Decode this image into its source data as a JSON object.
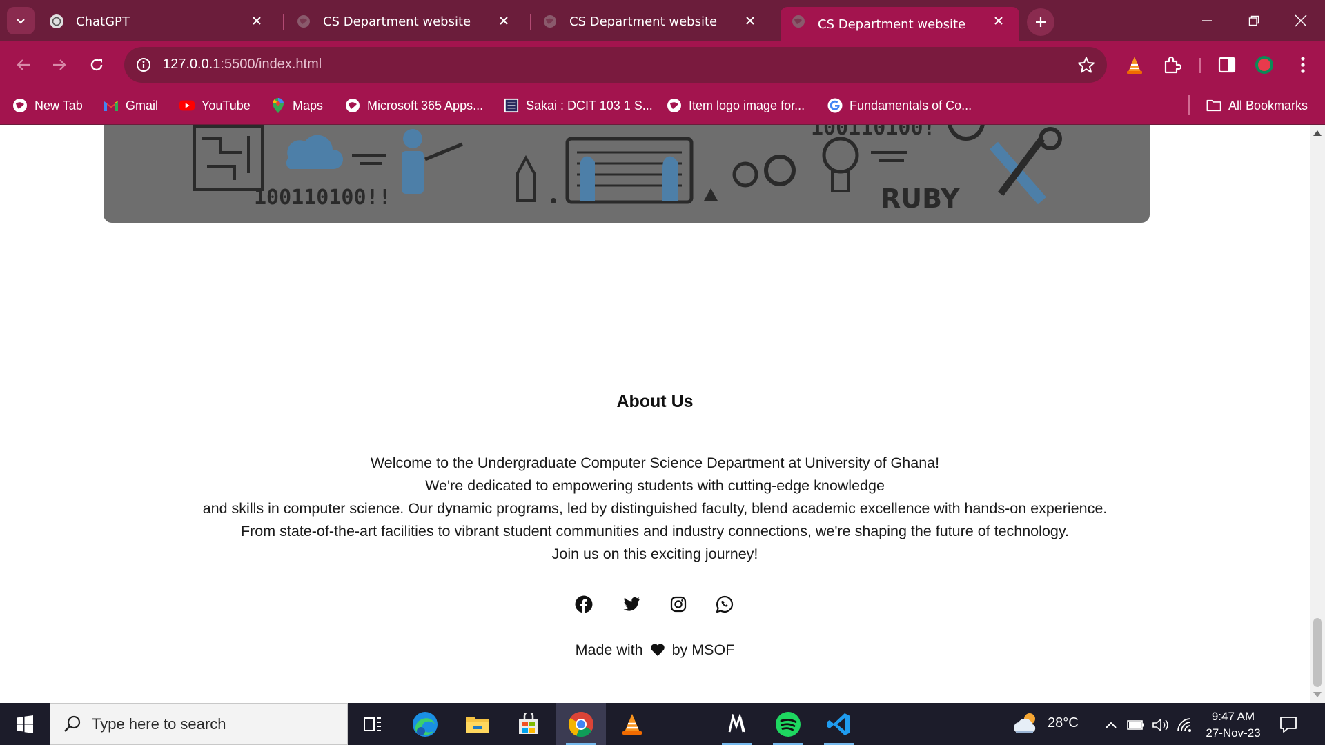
{
  "browser": {
    "tabs": [
      {
        "title": "ChatGPT",
        "favicon": "chatgpt-icon",
        "active": false
      },
      {
        "title": "CS Department website",
        "favicon": "globe-icon",
        "active": false
      },
      {
        "title": "CS Department website",
        "favicon": "globe-icon",
        "active": false
      },
      {
        "title": "CS Department website",
        "favicon": "globe-icon",
        "active": true
      }
    ],
    "url_host": "127.0.0.1",
    "url_path": ":5500/index.html",
    "bookmarks": [
      {
        "label": "New Tab",
        "icon": "globe-icon"
      },
      {
        "label": "Gmail",
        "icon": "gmail-icon"
      },
      {
        "label": "YouTube",
        "icon": "youtube-icon"
      },
      {
        "label": "Maps",
        "icon": "maps-icon"
      },
      {
        "label": "Microsoft 365 Apps...",
        "icon": "globe-icon"
      },
      {
        "label": "Sakai : DCIT 103 1 S...",
        "icon": "sakai-icon"
      },
      {
        "label": "Item logo image for...",
        "icon": "globe-icon"
      },
      {
        "label": "Fundamentals of Co...",
        "icon": "google-icon"
      }
    ],
    "all_bookmarks_label": "All Bookmarks",
    "colors": {
      "tabstrip": "#6b1d3b",
      "toolbar": "#a3144e"
    }
  },
  "page": {
    "hero_text": {
      "binary": "100110100!!",
      "ruby": "RUBY",
      "binary_top": "100110100!"
    },
    "about": {
      "title": "About Us",
      "lines": [
        "Welcome to the Undergraduate Computer Science Department at University of Ghana!",
        "We're dedicated to empowering students with cutting-edge knowledge",
        "and skills in computer science. Our dynamic programs, led by distinguished faculty, blend academic excellence with hands-on experience.",
        "From state-of-the-art facilities to vibrant student communities and industry connections, we're shaping the future of technology.",
        "Join us on this exciting journey!"
      ]
    },
    "social": [
      "facebook-icon",
      "twitter-icon",
      "instagram-icon",
      "whatsapp-icon"
    ],
    "footer": {
      "made_with": "Made with",
      "by": "by MSOF"
    }
  },
  "taskbar": {
    "search_placeholder": "Type here to search",
    "apps": [
      "task-view-icon",
      "edge-icon",
      "file-explorer-icon",
      "store-icon",
      "chrome-icon",
      "vlc-icon",
      "m-app-icon",
      "spotify-icon",
      "vscode-icon"
    ],
    "weather": "28°C",
    "time": "9:47 AM",
    "date": "27-Nov-23"
  }
}
